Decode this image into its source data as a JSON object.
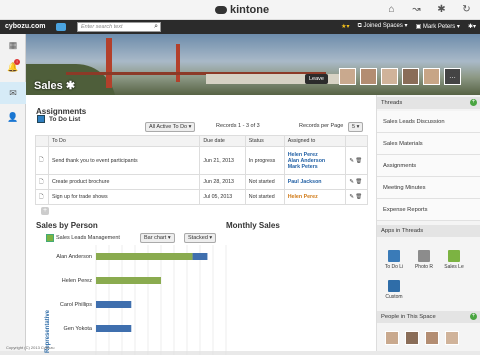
{
  "app": {
    "name": "kintone"
  },
  "topicons": [
    "home-icon",
    "alert-icon",
    "gear-icon",
    "refresh-icon"
  ],
  "nav": {
    "brand": "cybozu.com",
    "search_placeholder": "Enter search text",
    "joined_spaces": "Joined Spaces",
    "user": "Mark Peters"
  },
  "space": {
    "title": "Sales",
    "leave": "Leave",
    "more": "…"
  },
  "assignments": {
    "title": "Assignments",
    "list_name": "To Do List",
    "filter": "All Active To Do",
    "records_info": "Records 1 - 3 of 3",
    "per_page_label": "Records per Page",
    "per_page": "5",
    "columns": [
      "To Do",
      "Due date",
      "Status",
      "Assigned to"
    ],
    "rows": [
      {
        "todo": "Send thank you to event participants",
        "due": "Jun 21, 2013",
        "status": "In progress",
        "assigned": [
          "Helen Perez",
          "Alan Anderson",
          "Mark Peters"
        ]
      },
      {
        "todo": "Create product brochure",
        "due": "Jun 28, 2013",
        "status": "Not started",
        "assigned": [
          "Paul Jackson"
        ]
      },
      {
        "todo": "Sign up for trade shows",
        "due": "Jul 05, 2013",
        "status": "Not started",
        "assigned": [
          "Helen Perez"
        ]
      }
    ]
  },
  "sales_by_person": {
    "title": "Sales by Person",
    "app_name": "Sales Leads Management",
    "chart_type_select": "Bar chart",
    "stack_select": "Stacked",
    "monthly_title": "Monthly Sales"
  },
  "chart_data": {
    "type": "bar",
    "orientation": "horizontal",
    "stacked": true,
    "categories": [
      "Alan Anderson",
      "Helen Perez",
      "Carol Phillips",
      "Gen Yokota"
    ],
    "series": [
      {
        "color": "#8aab4f",
        "values": [
          52,
          35,
          0,
          0
        ]
      },
      {
        "color": "#3f6fae",
        "values": [
          8,
          0,
          19,
          19
        ]
      }
    ],
    "xlim": [
      0,
      70
    ],
    "ylabel": "Representative",
    "grid": true
  },
  "sidebar": {
    "threads_title": "Threads",
    "threads": [
      "Sales Leads Discussion",
      "Sales Materials",
      "Assignments",
      "Meeting Minutes",
      "Expense Reports"
    ],
    "apps_title": "Apps in Threads",
    "apps": [
      "To Do Li",
      "Photo R",
      "Sales Le",
      "Custom"
    ],
    "people_title": "People in This Space"
  },
  "footer": {
    "copyright": "Copyright (C) 2013 Cybozu"
  }
}
